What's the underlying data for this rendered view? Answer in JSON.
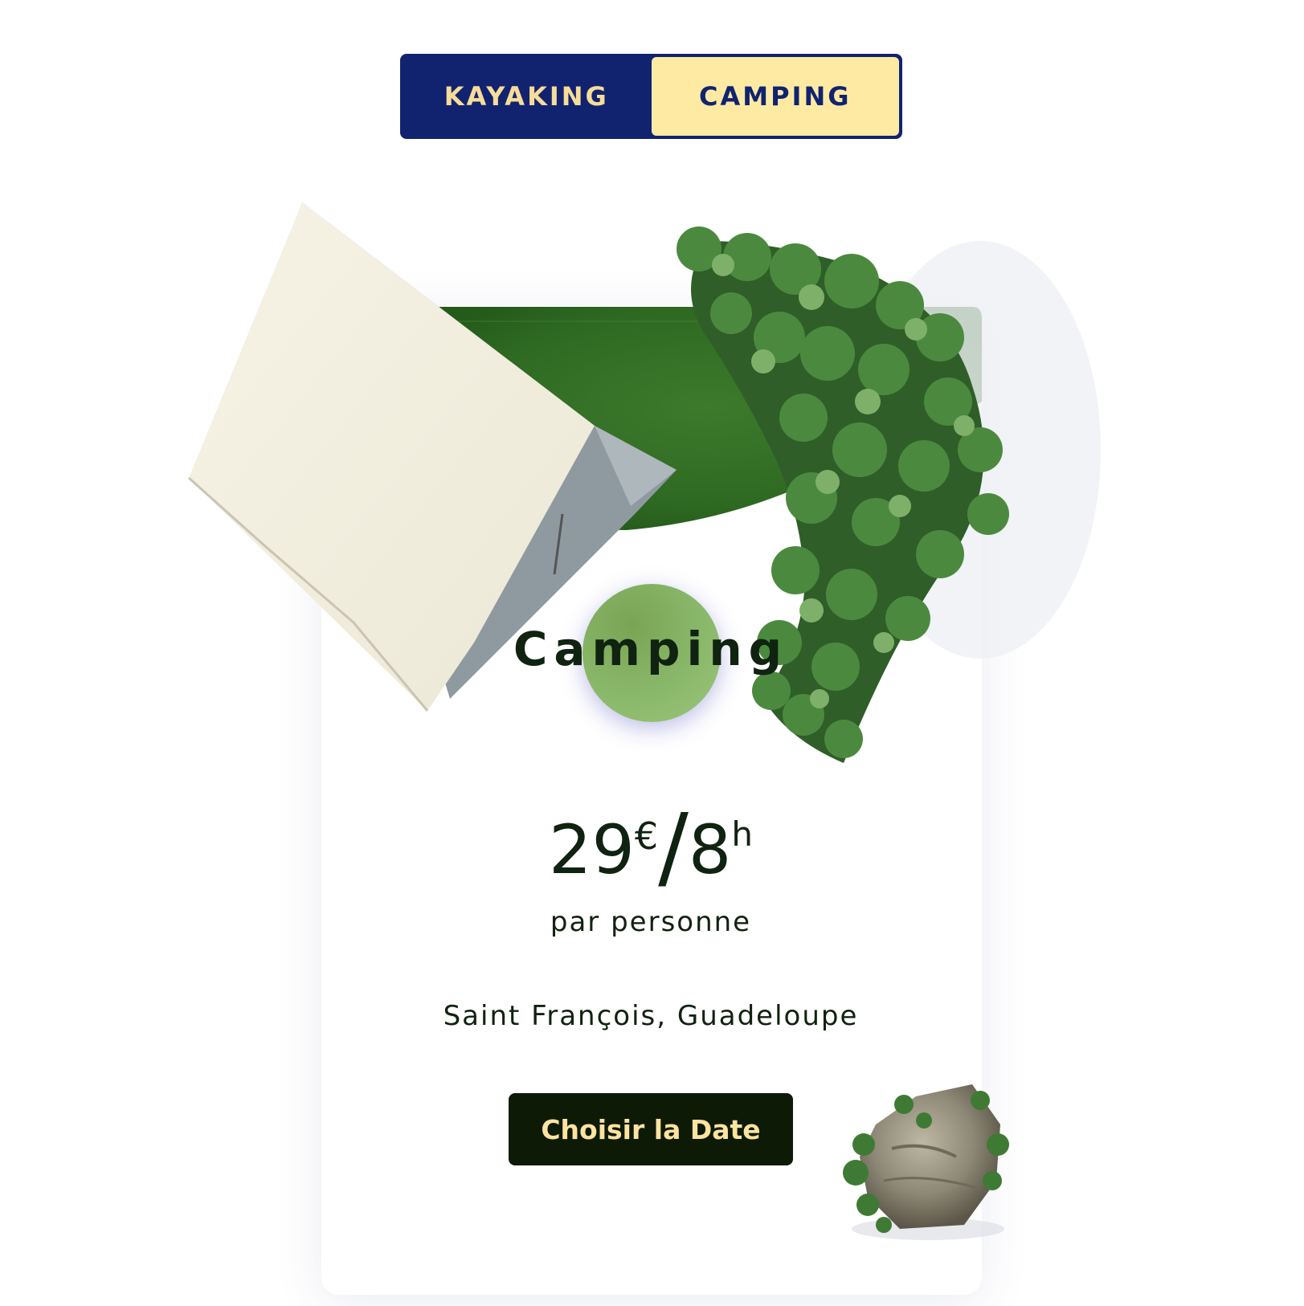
{
  "tabs": [
    {
      "label": "KAYAKING",
      "active": false
    },
    {
      "label": "CAMPING",
      "active": true
    }
  ],
  "card": {
    "title": "Camping",
    "price_amount": "29",
    "price_currency": "€",
    "price_separator": "/",
    "price_duration": "8",
    "price_unit": "h",
    "per_person": "par personne",
    "location": "Saint François, Guadeloupe",
    "cta_label": "Choisir la Date"
  },
  "colors": {
    "navy": "#11236f",
    "cream": "#ffeaa4",
    "dark_green": "#0d1b06",
    "badge_green": "#8ab86a"
  },
  "icons": [
    "tent-illustration",
    "grass-illustration",
    "ivy-illustration",
    "rock-illustration"
  ]
}
